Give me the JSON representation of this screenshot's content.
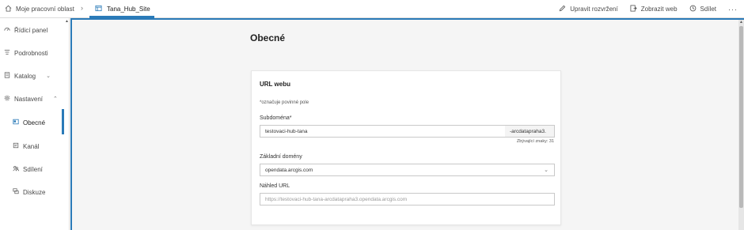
{
  "topbar": {
    "workspace_label": "Moje pracovní oblast",
    "site_label": "Tana_Hub_Site",
    "actions": {
      "edit_layout": "Upravit rozvržení",
      "view_site": "Zobrazit web",
      "share": "Sdílet",
      "more": "···"
    }
  },
  "sidebar": {
    "items": [
      {
        "label": "Řídicí panel",
        "icon": "dashboard-icon"
      },
      {
        "label": "Podrobnosti",
        "icon": "details-icon"
      },
      {
        "label": "Katalog",
        "icon": "catalog-icon"
      },
      {
        "label": "Nastavení",
        "icon": "settings-icon"
      },
      {
        "label": "Obecné",
        "icon": "general-icon"
      },
      {
        "label": "Kanál",
        "icon": "feed-icon"
      },
      {
        "label": "Sdílení",
        "icon": "sharing-icon"
      },
      {
        "label": "Diskuze",
        "icon": "discussion-icon"
      }
    ]
  },
  "main": {
    "title": "Obecné",
    "card": {
      "title": "URL webu",
      "required_note": "*označuje povinné pole",
      "subdomain": {
        "label": "Subdoména*",
        "value": "testovaci-hub-tana",
        "suffix": "-arcdatapraha3.",
        "remaining": "Zbývající znaky: 31"
      },
      "base_domain": {
        "label": "Základní domény",
        "value": "opendata.arcgis.com"
      },
      "preview": {
        "label": "Náhled URL",
        "value": "https://testovaci-hub-tana-arcdatapraha3.opendata.arcgis.com"
      }
    }
  },
  "colors": {
    "accent": "#2a7ab8",
    "background": "#f5f5f5"
  }
}
